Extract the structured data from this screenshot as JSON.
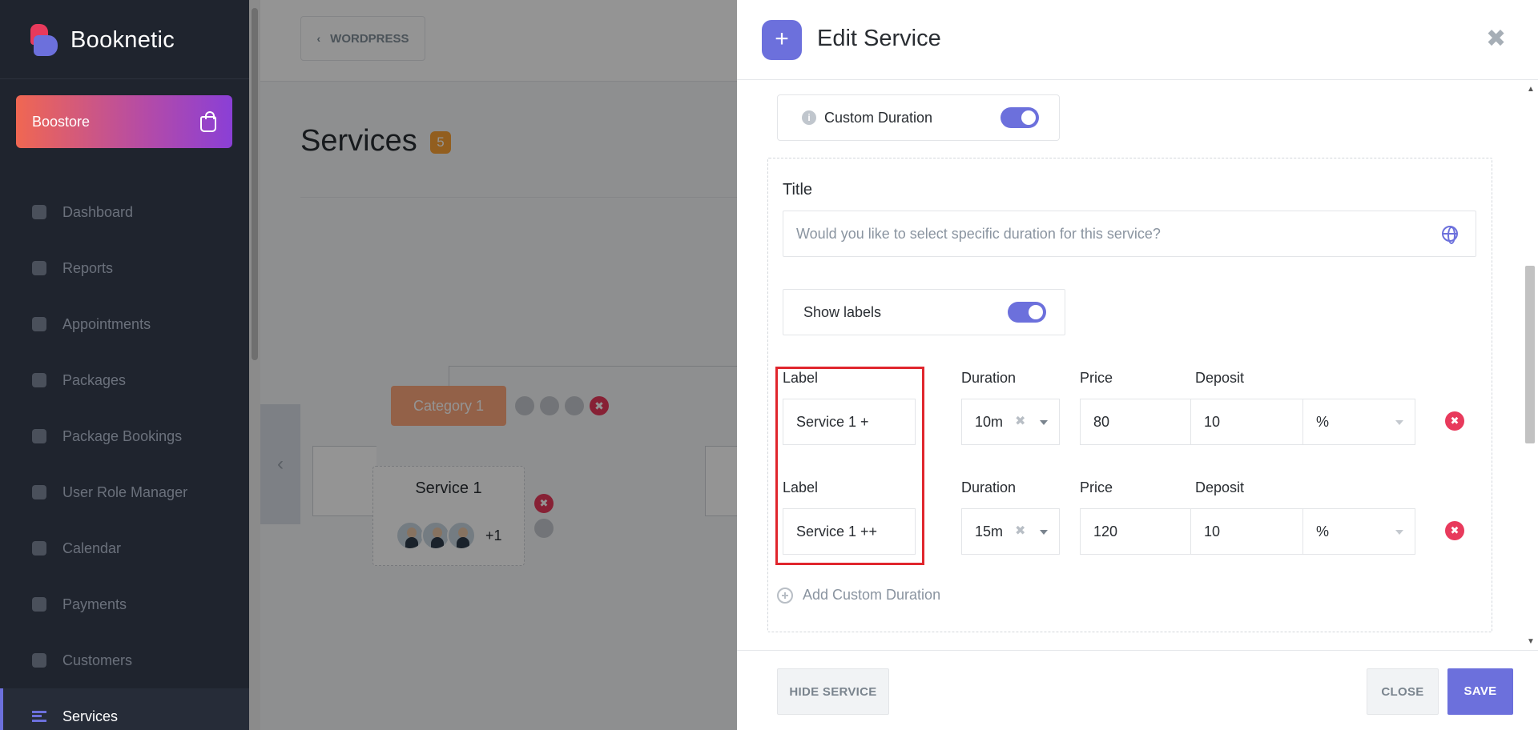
{
  "app": {
    "name": "Booknetic"
  },
  "sidebar": {
    "boostore_label": "Boostore",
    "items": [
      {
        "label": "Dashboard",
        "icon": "cube-icon"
      },
      {
        "label": "Reports",
        "icon": "chart-icon"
      },
      {
        "label": "Appointments",
        "icon": "clock-icon"
      },
      {
        "label": "Packages",
        "icon": "boxes-icon"
      },
      {
        "label": "Package Bookings",
        "icon": "box-open-icon"
      },
      {
        "label": "User Role Manager",
        "icon": "user-plus-icon"
      },
      {
        "label": "Calendar",
        "icon": "calendar-icon"
      },
      {
        "label": "Payments",
        "icon": "wallet-icon"
      },
      {
        "label": "Customers",
        "icon": "users-icon"
      },
      {
        "label": "Services",
        "icon": "list-icon",
        "active": true
      }
    ]
  },
  "main": {
    "wordpress_label": "WORDPRESS",
    "page_title": "Services",
    "services_count": "5",
    "category_label": "Category 1",
    "service_name": "Service 1",
    "staff_more": "+1"
  },
  "modal": {
    "title": "Edit Service",
    "custom_duration_label": "Custom Duration",
    "title_field_label": "Title",
    "title_placeholder": "Would you like to select specific duration for this service?",
    "show_labels_label": "Show labels",
    "column_labels": {
      "label": "Label",
      "duration": "Duration",
      "price": "Price",
      "deposit": "Deposit"
    },
    "rows": [
      {
        "label": "Service 1 +",
        "duration": "10m",
        "price": "80",
        "deposit": "10",
        "deposit_type": "%"
      },
      {
        "label": "Service 1 ++",
        "duration": "15m",
        "price": "120",
        "deposit": "10",
        "deposit_type": "%"
      }
    ],
    "add_custom_duration": "Add Custom Duration",
    "footer": {
      "hide_service": "HIDE SERVICE",
      "close": "CLOSE",
      "save": "SAVE"
    }
  },
  "colors": {
    "accent": "#6c70dc",
    "danger": "#e83a5c",
    "highlight": "#e0262d",
    "sidebar_bg": "#1f242e"
  }
}
